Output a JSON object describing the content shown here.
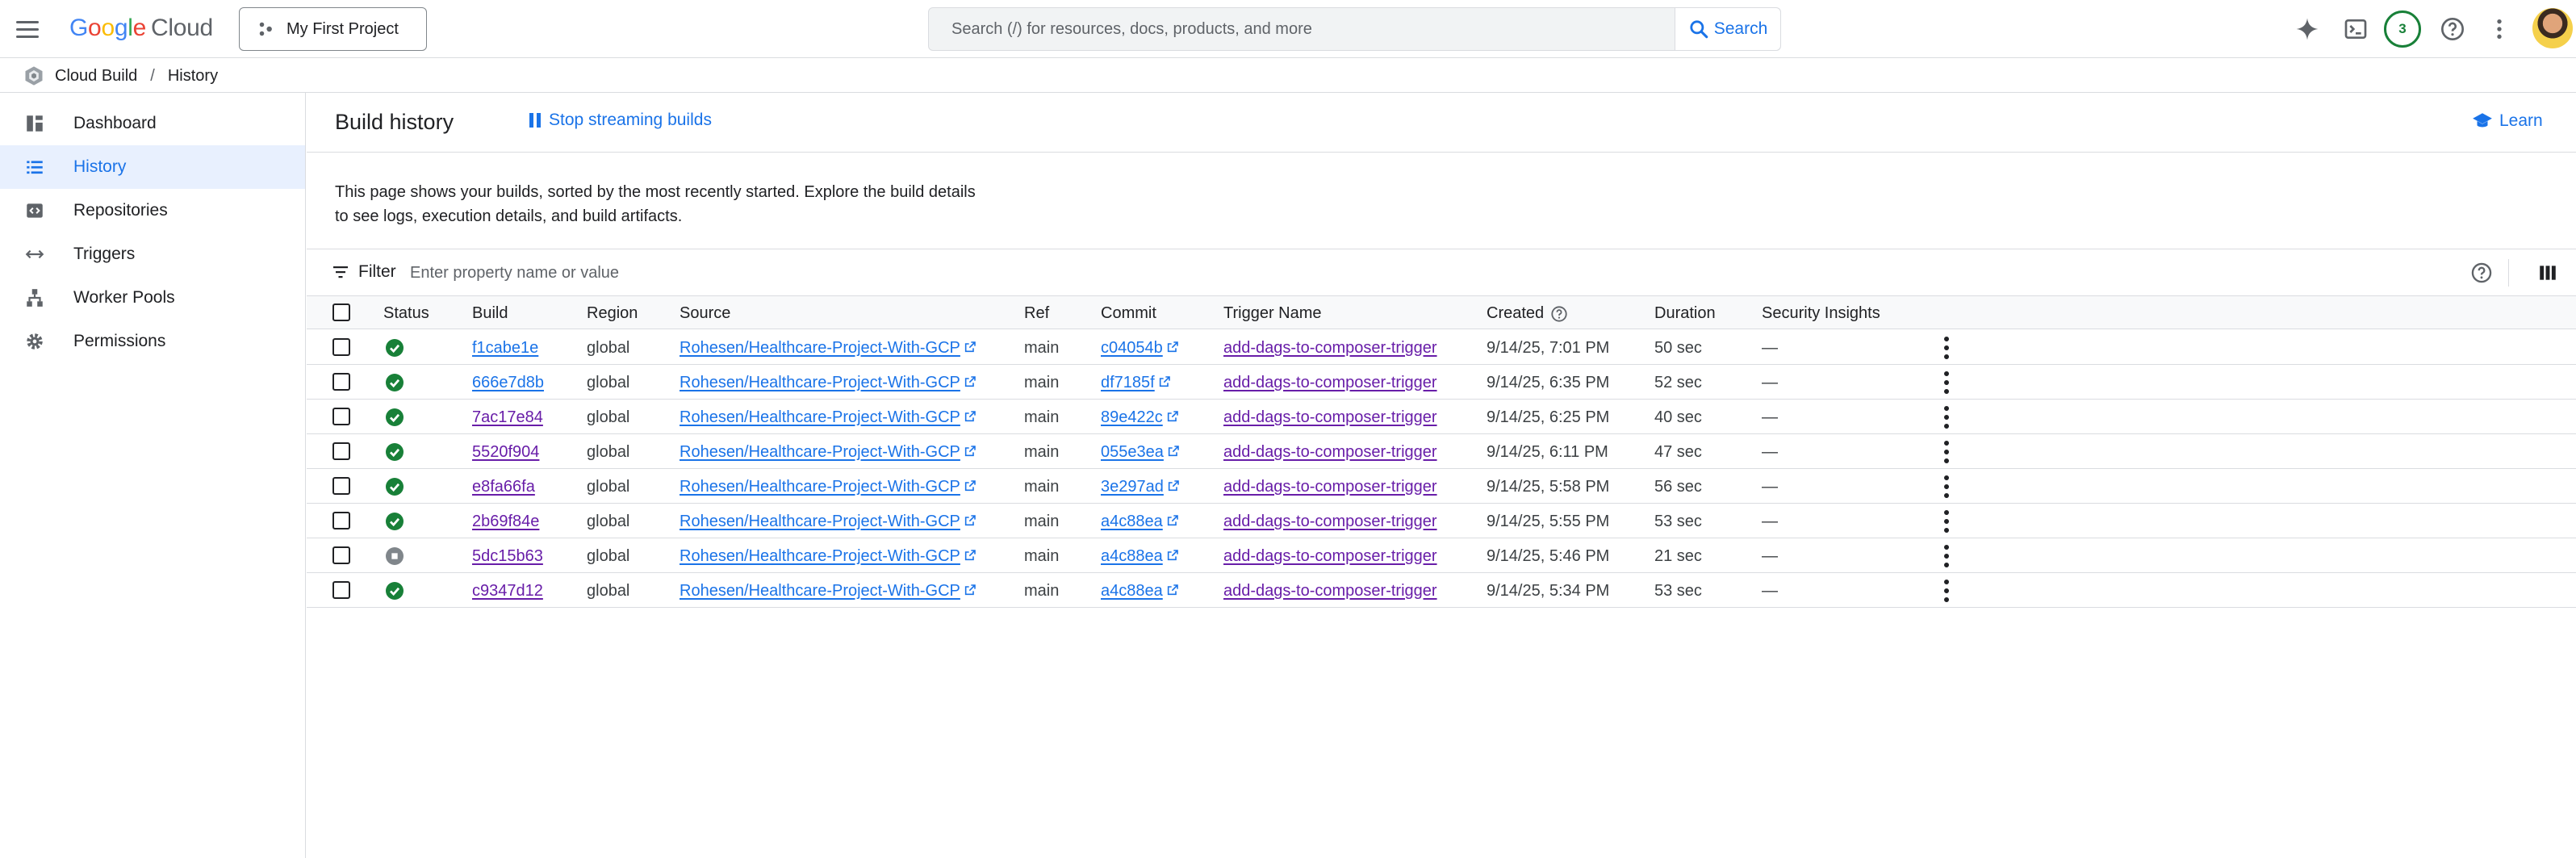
{
  "topbar": {
    "logo_google": [
      "G",
      "o",
      "o",
      "g",
      "l",
      "e"
    ],
    "logo_cloud": "Cloud",
    "project_name": "My First Project",
    "search_placeholder": "Search (/) for resources, docs, products, and more",
    "search_button": "Search",
    "notifications_count": "3"
  },
  "breadcrumb": {
    "service": "Cloud Build",
    "separator": "/",
    "page": "History"
  },
  "sidebar": {
    "items": [
      {
        "label": "Dashboard",
        "icon": "dashboard-icon"
      },
      {
        "label": "History",
        "icon": "list-icon",
        "active": true
      },
      {
        "label": "Repositories",
        "icon": "repository-icon"
      },
      {
        "label": "Triggers",
        "icon": "arrows-icon"
      },
      {
        "label": "Worker Pools",
        "icon": "worker-pools-icon"
      },
      {
        "label": "Permissions",
        "icon": "gear-icon"
      }
    ]
  },
  "main": {
    "title": "Build history",
    "stop_streaming": "Stop streaming builds",
    "learn": "Learn",
    "description": "This page shows your builds, sorted by the most recently started. Explore the build details to see logs, execution details, and build artifacts.",
    "filter_label": "Filter",
    "filter_placeholder": "Enter property name or value"
  },
  "table": {
    "columns": [
      "Status",
      "Build",
      "Region",
      "Source",
      "Ref",
      "Commit",
      "Trigger Name",
      "Created",
      "Duration",
      "Security Insights"
    ],
    "rows": [
      {
        "status": "success",
        "build": "f1cabe1e",
        "region": "global",
        "source": "Rohesen/Healthcare-Project-With-GCP",
        "ref": "main",
        "commit": "c04054b",
        "trigger": "add-dags-to-composer-trigger",
        "created": "9/14/25, 7:01 PM",
        "duration": "50 sec",
        "insights": "—",
        "build_visited": false
      },
      {
        "status": "success",
        "build": "666e7d8b",
        "region": "global",
        "source": "Rohesen/Healthcare-Project-With-GCP",
        "ref": "main",
        "commit": "df7185f",
        "trigger": "add-dags-to-composer-trigger",
        "created": "9/14/25, 6:35 PM",
        "duration": "52 sec",
        "insights": "—",
        "build_visited": false
      },
      {
        "status": "success",
        "build": "7ac17e84",
        "region": "global",
        "source": "Rohesen/Healthcare-Project-With-GCP",
        "ref": "main",
        "commit": "89e422c",
        "trigger": "add-dags-to-composer-trigger",
        "created": "9/14/25, 6:25 PM",
        "duration": "40 sec",
        "insights": "—",
        "build_visited": true
      },
      {
        "status": "success",
        "build": "5520f904",
        "region": "global",
        "source": "Rohesen/Healthcare-Project-With-GCP",
        "ref": "main",
        "commit": "055e3ea",
        "trigger": "add-dags-to-composer-trigger",
        "created": "9/14/25, 6:11 PM",
        "duration": "47 sec",
        "insights": "—",
        "build_visited": true
      },
      {
        "status": "success",
        "build": "e8fa66fa",
        "region": "global",
        "source": "Rohesen/Healthcare-Project-With-GCP",
        "ref": "main",
        "commit": "3e297ad",
        "trigger": "add-dags-to-composer-trigger",
        "created": "9/14/25, 5:58 PM",
        "duration": "56 sec",
        "insights": "—",
        "build_visited": true
      },
      {
        "status": "success",
        "build": "2b69f84e",
        "region": "global",
        "source": "Rohesen/Healthcare-Project-With-GCP",
        "ref": "main",
        "commit": "a4c88ea",
        "trigger": "add-dags-to-composer-trigger",
        "created": "9/14/25, 5:55 PM",
        "duration": "53 sec",
        "insights": "—",
        "build_visited": true
      },
      {
        "status": "cancelled",
        "build": "5dc15b63",
        "region": "global",
        "source": "Rohesen/Healthcare-Project-With-GCP",
        "ref": "main",
        "commit": "a4c88ea",
        "trigger": "add-dags-to-composer-trigger",
        "created": "9/14/25, 5:46 PM",
        "duration": "21 sec",
        "insights": "—",
        "build_visited": true
      },
      {
        "status": "success",
        "build": "c9347d12",
        "region": "global",
        "source": "Rohesen/Healthcare-Project-With-GCP",
        "ref": "main",
        "commit": "a4c88ea",
        "trigger": "add-dags-to-composer-trigger",
        "created": "9/14/25, 5:34 PM",
        "duration": "53 sec",
        "insights": "—",
        "build_visited": true
      }
    ]
  },
  "colors": {
    "accent": "#1a73e8",
    "visited_link": "#681da8",
    "success": "#188038",
    "cancelled": "#80868b"
  }
}
